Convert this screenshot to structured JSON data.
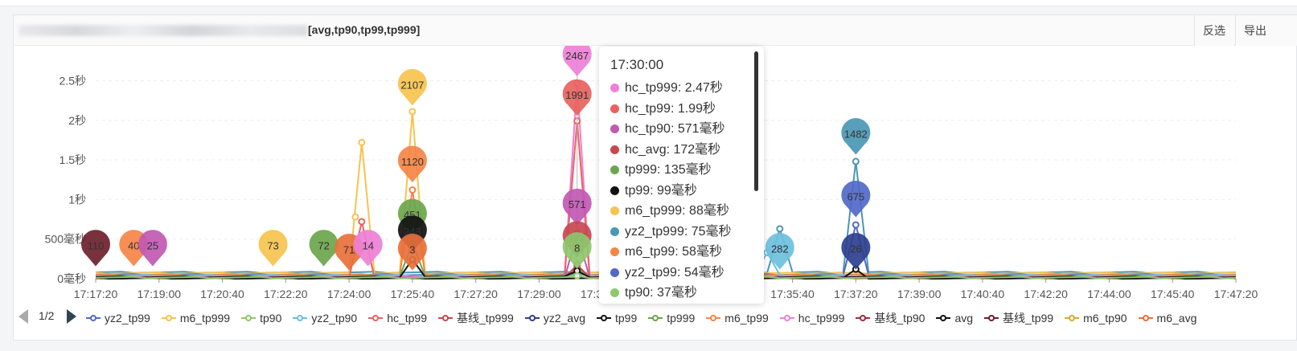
{
  "panel": {
    "title": "[avg,tp90,tp99,tp999]",
    "invert_label": "反选",
    "export_label": "导出"
  },
  "tooltip": {
    "time": "17:30:00",
    "rows": [
      {
        "text": "hc_tp999: 2.47秒",
        "color": "#ee7fd6"
      },
      {
        "text": "hc_tp99: 1.99秒",
        "color": "#e8625f"
      },
      {
        "text": "hc_tp90: 571毫秒",
        "color": "#c159b3"
      },
      {
        "text": "hc_avg: 172毫秒",
        "color": "#c9474f"
      },
      {
        "text": "tp999: 135毫秒",
        "color": "#6ba54c"
      },
      {
        "text": "tp99: 99毫秒",
        "color": "#111111"
      },
      {
        "text": "m6_tp999: 88毫秒",
        "color": "#f6c34e"
      },
      {
        "text": "yz2_tp999: 75毫秒",
        "color": "#4a97b4"
      },
      {
        "text": "m6_tp99: 58毫秒",
        "color": "#f58447"
      },
      {
        "text": "yz2_tp99: 54毫秒",
        "color": "#5168c8"
      },
      {
        "text": "tp90: 37毫秒",
        "color": "#8dc86c"
      }
    ]
  },
  "legend": {
    "page": "1/2",
    "items": [
      {
        "name": "yz2_tp99",
        "color": "#5168c8"
      },
      {
        "name": "m6_tp999",
        "color": "#f6c34e"
      },
      {
        "name": "tp90",
        "color": "#8dc86c"
      },
      {
        "name": "yz2_tp90",
        "color": "#6cc0de"
      },
      {
        "name": "hc_tp99",
        "color": "#e8625f"
      },
      {
        "name": "基线_tp999",
        "color": "#c9474f"
      },
      {
        "name": "yz2_avg",
        "color": "#2e3f8f"
      },
      {
        "name": "tp99",
        "color": "#111111"
      },
      {
        "name": "tp999",
        "color": "#6ba54c"
      },
      {
        "name": "m6_tp99",
        "color": "#f58447"
      },
      {
        "name": "hc_tp999",
        "color": "#ee7fd6"
      },
      {
        "name": "基线_tp90",
        "color": "#a1283f"
      },
      {
        "name": "avg",
        "color": "#111111"
      },
      {
        "name": "基线_tp99",
        "color": "#6e1f2e"
      },
      {
        "name": "m6_tp90",
        "color": "#e0a430"
      },
      {
        "name": "m6_avg",
        "color": "#e8703c"
      }
    ]
  },
  "chart_data": {
    "type": "line",
    "ylim": [
      0,
      2.9
    ],
    "y_unit": "秒",
    "y_ticks": [
      {
        "value": 0,
        "label": "0毫秒"
      },
      {
        "value": 0.5,
        "label": "500毫秒"
      },
      {
        "value": 1,
        "label": "1秒"
      },
      {
        "value": 1.5,
        "label": "1.5秒"
      },
      {
        "value": 2,
        "label": "2秒"
      },
      {
        "value": 2.5,
        "label": "2.5秒"
      }
    ],
    "x_range": [
      "17:17:20",
      "17:47:20"
    ],
    "x_ticks": [
      "17:17:20",
      "17:19:00",
      "17:20:40",
      "17:22:20",
      "17:24:00",
      "17:25:40",
      "17:27:20",
      "17:29:00",
      "17:30:40",
      "17:32:20",
      "17:34:00",
      "17:35:40",
      "17:37:20",
      "17:39:00",
      "17:40:40",
      "17:42:20",
      "17:44:00",
      "17:45:40",
      "17:47:20"
    ],
    "grid": true,
    "legend_position": "bottom",
    "series": [
      {
        "name": "yz2_tp999",
        "color": "#4a97b4",
        "baseline": 0.08,
        "peaks": [
          [
            "17:35:20",
            0.63
          ],
          [
            "17:37:20",
            1.48
          ]
        ]
      },
      {
        "name": "m6_tp999",
        "color": "#f6c34e",
        "baseline": 0.07,
        "peaks": [
          [
            "17:24:20",
            1.72
          ],
          [
            "17:24:10",
            0.78
          ],
          [
            "17:25:40",
            2.11
          ]
        ]
      },
      {
        "name": "yz2_tp99",
        "color": "#5168c8",
        "baseline": 0.05,
        "peaks": [
          [
            "17:37:20",
            0.68
          ]
        ]
      },
      {
        "name": "m6_tp99",
        "color": "#f58447",
        "baseline": 0.05,
        "peaks": [
          [
            "17:25:40",
            1.12
          ]
        ]
      },
      {
        "name": "yz2_tp90",
        "color": "#6cc0de",
        "baseline": 0.04,
        "peaks": [
          [
            "17:35:00",
            0.33
          ]
        ]
      },
      {
        "name": "tp999",
        "color": "#6ba54c",
        "baseline": 0.03,
        "peaks": [
          [
            "17:25:40",
            0.45
          ],
          [
            "17:30:00",
            0.135
          ]
        ]
      },
      {
        "name": "hc_tp999",
        "color": "#ee7fd6",
        "baseline": 0.02,
        "peaks": [
          [
            "17:30:00",
            2.467
          ]
        ]
      },
      {
        "name": "hc_tp99",
        "color": "#e8625f",
        "baseline": 0.015,
        "peaks": [
          [
            "17:30:00",
            1.991
          ],
          [
            "17:24:20",
            0.72
          ]
        ]
      },
      {
        "name": "hc_tp90",
        "color": "#c159b3",
        "baseline": 0.01,
        "peaks": [
          [
            "17:30:00",
            0.571
          ]
        ]
      },
      {
        "name": "hc_avg",
        "color": "#c9474f",
        "baseline": 0.01,
        "peaks": [
          [
            "17:30:00",
            0.172
          ]
        ]
      },
      {
        "name": "tp99",
        "color": "#111111",
        "baseline": 0.02,
        "peaks": [
          [
            "17:25:40",
            0.243
          ],
          [
            "17:30:00",
            0.099
          ]
        ]
      },
      {
        "name": "avg",
        "color": "#111111",
        "baseline": 0.005,
        "peaks": [
          [
            "17:37:20",
            0.12
          ]
        ]
      },
      {
        "name": "tp90",
        "color": "#8dc86c",
        "baseline": 0.015,
        "peaks": [
          [
            "17:30:00",
            0.037
          ]
        ]
      }
    ],
    "markers": [
      {
        "label": "110",
        "time": "17:17:20",
        "value": 0.38,
        "color": "#6e1f2e"
      },
      {
        "label": "40",
        "time": "17:18:20",
        "value": 0.38,
        "color": "#f58447"
      },
      {
        "label": "25",
        "time": "17:18:50",
        "value": 0.38,
        "color": "#c159b3"
      },
      {
        "label": "73",
        "time": "17:22:00",
        "value": 0.38,
        "color": "#f6c34e"
      },
      {
        "label": "72",
        "time": "17:23:20",
        "value": 0.38,
        "color": "#6ba54c"
      },
      {
        "label": "71",
        "time": "17:24:00",
        "value": 0.33,
        "color": "#e8703c"
      },
      {
        "label": "14",
        "time": "17:24:30",
        "value": 0.38,
        "color": "#ee7fd6"
      },
      {
        "label": "2107",
        "time": "17:25:40",
        "value": 2.41,
        "color": "#f6c34e"
      },
      {
        "label": "1120",
        "time": "17:25:40",
        "value": 1.44,
        "color": "#f58447"
      },
      {
        "label": "451",
        "time": "17:25:40",
        "value": 0.77,
        "color": "#6ba54c"
      },
      {
        "label": "243",
        "time": "17:25:40",
        "value": 0.56,
        "color": "#111111"
      },
      {
        "label": "3",
        "time": "17:25:40",
        "value": 0.33,
        "color": "#e8703c"
      },
      {
        "label": "2467",
        "time": "17:30:00",
        "value": 2.78,
        "color": "#ee7fd6"
      },
      {
        "label": "1991",
        "time": "17:30:00",
        "value": 2.28,
        "color": "#e8625f"
      },
      {
        "label": "571",
        "time": "17:30:00",
        "value": 0.9,
        "color": "#c159b3"
      },
      {
        "label": "172",
        "time": "17:30:00",
        "value": 0.49,
        "color": "#c9474f"
      },
      {
        "label": "8",
        "time": "17:30:00",
        "value": 0.35,
        "color": "#8dc86c"
      },
      {
        "label": "282",
        "time": "17:35:20",
        "value": 0.34,
        "color": "#6cc0de"
      },
      {
        "label": "1482",
        "time": "17:37:20",
        "value": 1.79,
        "color": "#4a97b4"
      },
      {
        "label": "675",
        "time": "17:37:20",
        "value": 1.0,
        "color": "#5168c8"
      },
      {
        "label": "26",
        "time": "17:37:20",
        "value": 0.34,
        "color": "#2e3f8f"
      }
    ]
  }
}
